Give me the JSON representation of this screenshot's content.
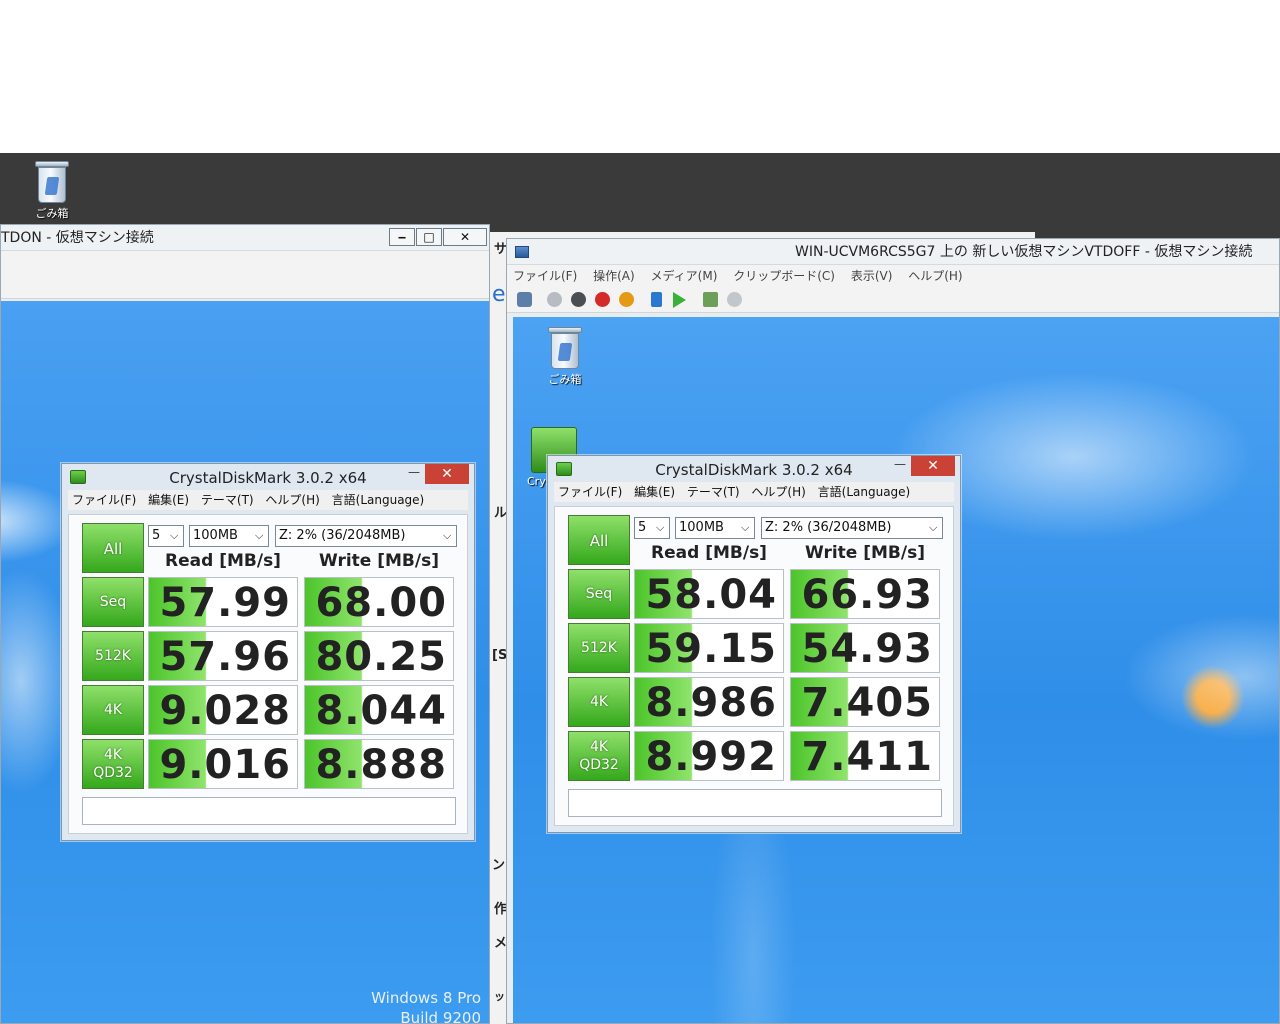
{
  "host": {
    "recycle_bin_label": "ごみ箱"
  },
  "left_vm": {
    "title": "TDON  - 仮想マシン接続",
    "controls": {
      "minimize": "‒",
      "maximize": "□",
      "close": "✕"
    },
    "watermark": [
      "Windows 8 Pro",
      "Build 9200"
    ]
  },
  "middle_strip": {
    "chars": [
      "サ",
      "e",
      "ル",
      "[S",
      "ン",
      "作",
      "メ",
      "ッ"
    ]
  },
  "right_vm": {
    "title": "WIN-UCVM6RCS5G7 上の 新しい仮想マシンVTDOFF  - 仮想マシン接続",
    "menu": [
      "ファイル(F)",
      "操作(A)",
      "メディア(M)",
      "クリップボード(C)",
      "表示(V)",
      "ヘルプ(H)"
    ],
    "recycle_bin_label": "ごみ箱",
    "crystal_icon_label": "Cryst"
  },
  "cdm_common": {
    "title": "CrystalDiskMark 3.0.2 x64",
    "menu": [
      "ファイル(F)",
      "編集(E)",
      "テーマ(T)",
      "ヘルプ(H)",
      "言語(Language)"
    ],
    "all_label": "All",
    "count": "5",
    "size": "100MB",
    "drive": "Z: 2% (36/2048MB)",
    "read_header": "Read [MB/s]",
    "write_header": "Write [MB/s]",
    "rows": [
      {
        "label_1": "Seq",
        "label_2": ""
      },
      {
        "label_1": "512K",
        "label_2": ""
      },
      {
        "label_1": "4K",
        "label_2": ""
      },
      {
        "label_1": "4K",
        "label_2": "QD32"
      }
    ],
    "close": "✕",
    "minimize": "—"
  },
  "cdm_left": {
    "read": [
      "57.99",
      "57.96",
      "9.028",
      "9.016"
    ],
    "write": [
      "68.00",
      "80.25",
      "8.044",
      "8.888"
    ]
  },
  "cdm_right": {
    "read": [
      "58.04",
      "59.15",
      "8.986",
      "8.992"
    ],
    "write": [
      "66.93",
      "54.93",
      "7.405",
      "7.411"
    ]
  }
}
